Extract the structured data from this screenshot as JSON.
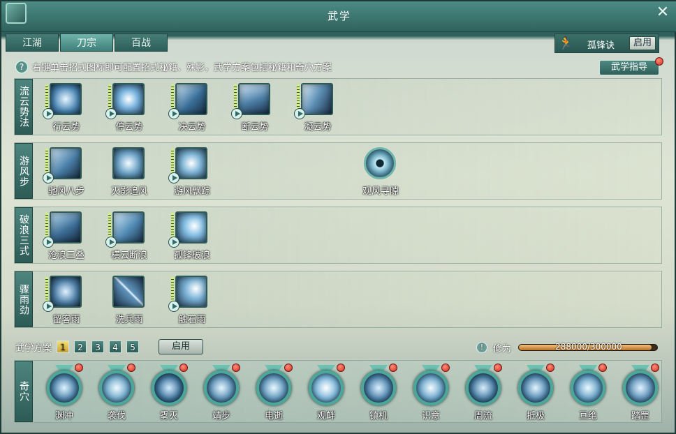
{
  "window": {
    "title": "武学",
    "close_icon": "close-icon"
  },
  "tabs": [
    "江湖",
    "刀宗",
    "百战"
  ],
  "active_tab": 1,
  "top_right": {
    "skill_name": "孤锋诀",
    "enable_label": "启用"
  },
  "hint": {
    "text": "右键单击招式图标即可配置招式秘籍、殊影，武学方案包括秘籍和奇穴方案",
    "guide_label": "武学指导"
  },
  "rows": [
    {
      "label": "流云势法",
      "skills": [
        "行云势",
        "停云势",
        "决云势",
        "断云势",
        "凝云势"
      ]
    },
    {
      "label": "游风步",
      "skills": [
        "驰风八步",
        "灭影追风",
        "游风飘踪",
        "观风寻隙"
      ]
    },
    {
      "label": "破浪三式",
      "skills": [
        "沧浪三叠",
        "横云断浪",
        "孤锋破浪"
      ]
    },
    {
      "label": "骤雨劲",
      "skills": [
        "留客雨",
        "洗兵雨",
        "触石雨"
      ]
    }
  ],
  "scheme": {
    "label": "武学方案",
    "numbers": [
      "1",
      "2",
      "3",
      "4",
      "5"
    ],
    "active": 0,
    "enable_label": "启用"
  },
  "cultivation": {
    "label": "修为",
    "current": 288000,
    "max": 300000,
    "text": "288000/300000"
  },
  "qixue": {
    "label": "奇穴",
    "items": [
      "渊冲",
      "袭伐",
      "雾灭",
      "靖步",
      "电逝",
      "观衅",
      "镇机",
      "识意",
      "周流",
      "抵极",
      "亘绝",
      "踏罡"
    ]
  },
  "colors": {
    "accent": "#3f807a",
    "red_dot": "#d42b1d"
  }
}
